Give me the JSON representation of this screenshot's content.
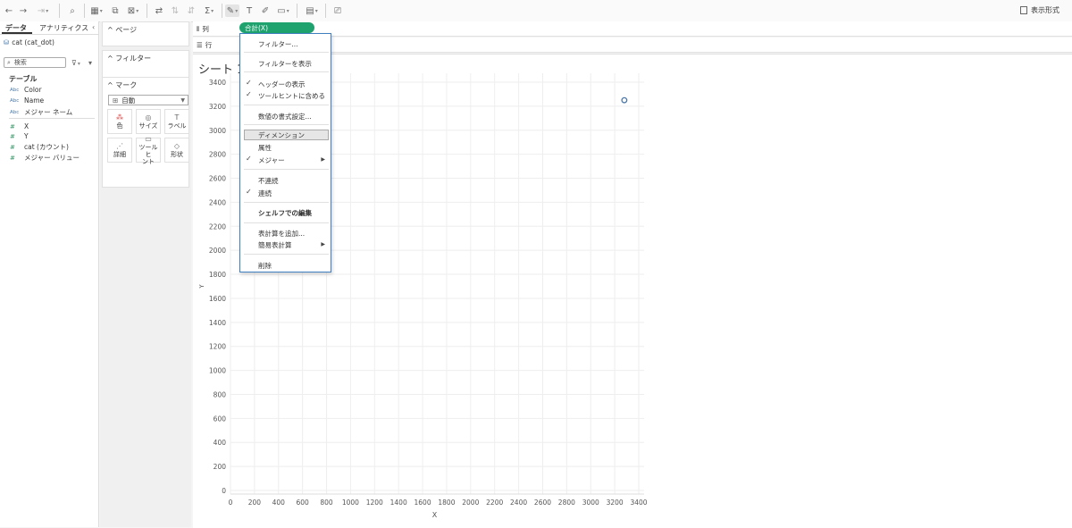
{
  "toolbar": {
    "icons": [
      "undo-icon",
      "redo-icon",
      "replay-icon",
      "new-data-source-icon",
      "new-worksheet-icon",
      "duplicate-icon",
      "clear-icon",
      "swap-icon",
      "sort-asc-icon",
      "sort-desc-icon",
      "sum-icon",
      "highlight-icon",
      "label-icon",
      "annotate-icon",
      "fit-icon",
      "show-me-icon",
      "presentation-icon"
    ],
    "present_label": "表示形式"
  },
  "data_pane": {
    "tab_data": "データ",
    "tab_analytics": "アナリティクス",
    "collapse_glyph": "‹",
    "datasource": "cat (cat_dot)",
    "search_placeholder": "検索",
    "table_header": "テーブル",
    "fields": [
      {
        "type": "Abc",
        "name": "Color"
      },
      {
        "type": "Abc",
        "name": "Name"
      },
      {
        "type": "Abc",
        "name": "メジャー ネーム"
      },
      {
        "type": "#",
        "name": "X"
      },
      {
        "type": "#",
        "name": "Y"
      },
      {
        "type": "#",
        "name": "cat (カウント)"
      },
      {
        "type": "#",
        "name": "メジャー バリュー"
      }
    ]
  },
  "cards": {
    "pages": "ページ",
    "filters": "フィルター",
    "marks": "マーク",
    "mark_type": "自動",
    "mark_buttons": [
      {
        "icon": "color-icon",
        "label": "色"
      },
      {
        "icon": "size-icon",
        "label": "サイズ"
      },
      {
        "icon": "label-icon",
        "label": "ラベル"
      },
      {
        "icon": "detail-icon",
        "label": "詳細"
      },
      {
        "icon": "tooltip-icon",
        "label": "ツールヒ\nント"
      },
      {
        "icon": "shape-icon",
        "label": "形状"
      }
    ]
  },
  "shelves": {
    "columns_label": "列",
    "rows_label": "行",
    "columns_pill": "合計(X)"
  },
  "sheet": {
    "title": "シート 1("
  },
  "context_menu": {
    "items": [
      {
        "label": "フィルター...",
        "checked": false
      },
      {
        "label": "フィルターを表示",
        "checked": false
      },
      {
        "label": "ヘッダーの表示",
        "checked": true
      },
      {
        "label": "ツールヒントに含める",
        "checked": true
      },
      {
        "label": "数値の書式設定...",
        "checked": false
      },
      {
        "label": "ディメンション",
        "checked": false,
        "highlighted": true
      },
      {
        "label": "属性",
        "checked": false
      },
      {
        "label": "メジャー",
        "checked": true,
        "submenu": true
      },
      {
        "label": "不連続",
        "checked": false
      },
      {
        "label": "連続",
        "checked": true
      },
      {
        "label": "シェルフでの編集",
        "checked": false,
        "bold": true
      },
      {
        "label": "表計算を追加...",
        "checked": false
      },
      {
        "label": "簡易表計算",
        "checked": false,
        "submenu": true
      },
      {
        "label": "削除",
        "checked": false
      }
    ]
  },
  "chart_data": {
    "type": "scatter",
    "xlabel": "X",
    "ylabel": "Y",
    "xlim": [
      0,
      3400
    ],
    "ylim": [
      0,
      3400
    ],
    "xticks": [
      0,
      200,
      400,
      600,
      800,
      1000,
      1200,
      1400,
      1600,
      1800,
      2000,
      2200,
      2400,
      2600,
      2800,
      3000,
      3200,
      3400
    ],
    "yticks": [
      0,
      200,
      400,
      600,
      800,
      1000,
      1200,
      1400,
      1600,
      1800,
      2000,
      2200,
      2400,
      2600,
      2800,
      3000,
      3200,
      3400
    ],
    "grid": true,
    "points": [
      {
        "x": 3280,
        "y": 3250
      }
    ],
    "point_color": "#4e79a7"
  }
}
